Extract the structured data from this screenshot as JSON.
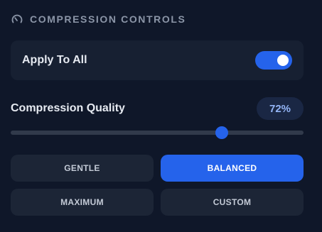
{
  "header": {
    "icon": "gauge-icon",
    "title": "COMPRESSION CONTROLS"
  },
  "apply_all": {
    "label": "Apply To All",
    "enabled": true
  },
  "quality": {
    "label": "Compression Quality",
    "value_text": "72%",
    "value": 72
  },
  "presets": [
    {
      "label": "GENTLE",
      "active": false
    },
    {
      "label": "BALANCED",
      "active": true
    },
    {
      "label": "MAXIMUM",
      "active": false
    },
    {
      "label": "CUSTOM",
      "active": false
    }
  ],
  "colors": {
    "accent": "#2563eb",
    "background": "#0f1729",
    "card": "#172032"
  }
}
